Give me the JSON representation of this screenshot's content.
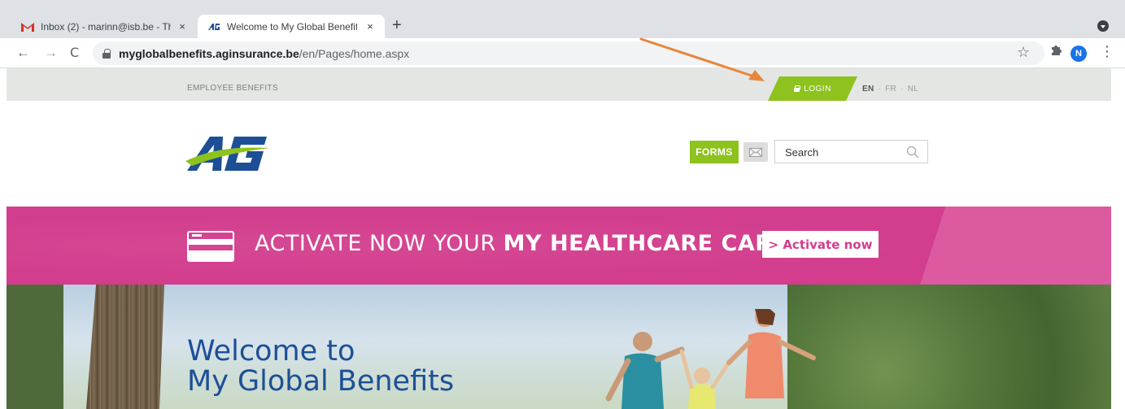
{
  "browser": {
    "tabs": [
      {
        "title": "Inbox (2) - marinn@isb.be - Th",
        "active": false,
        "icon": "gmail-icon"
      },
      {
        "title": "Welcome to My Global Benefit",
        "active": true,
        "icon": "ag-favicon"
      }
    ],
    "new_tab": "+",
    "close": "×",
    "url_host": "myglobalbenefits.aginsurance.be",
    "url_path": "/en/Pages/home.aspx",
    "profile_initial": "N",
    "nav": {
      "back": "←",
      "forward": "→",
      "reload": "C",
      "star": "☆",
      "menu": "⋮"
    }
  },
  "site": {
    "topbar_label": "EMPLOYEE BENEFITS",
    "login_label": "LOGIN",
    "languages": [
      "EN",
      "FR",
      "NL"
    ],
    "active_language": "EN",
    "forms_label": "FORMS",
    "search_placeholder": "Search",
    "logo_text": "AG"
  },
  "banner": {
    "text_light": "ACTIVATE NOW YOUR ",
    "text_bold": "MY HEALTHCARE CARD",
    "button_label": "> Activate now"
  },
  "hero": {
    "line1": "Welcome to",
    "line2": "My Global Benefits"
  },
  "colors": {
    "brand_green": "#8dc21f",
    "brand_pink": "#d23d8d",
    "brand_blue": "#1c4f96",
    "annotation": "#e8853a"
  }
}
